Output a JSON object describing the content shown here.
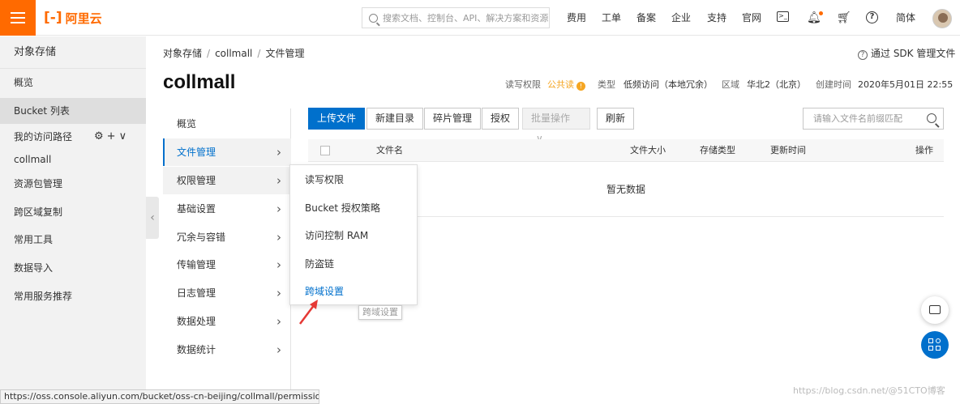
{
  "topbar": {
    "logo_text": "阿里云",
    "search_placeholder": "搜索文档、控制台、API、解决方案和资源",
    "nav": [
      "费用",
      "工单",
      "备案",
      "企业",
      "支持",
      "官网"
    ],
    "lang": "简体"
  },
  "left": {
    "title": "对象存储",
    "items": [
      "概览",
      "Bucket 列表",
      "我的访问路径",
      "collmall",
      "资源包管理",
      "跨区域复制",
      "常用工具",
      "数据导入",
      "常用服务推荐"
    ],
    "active_index": 1
  },
  "header": {
    "breadcrumb": [
      "对象存储",
      "collmall",
      "文件管理"
    ],
    "sdk_link": "通过 SDK 管理文件",
    "bucket_name": "collmall",
    "meta": {
      "rw_label": "读写权限",
      "rw_value": "公共读",
      "type_label": "类型",
      "type_value": "低频访问（本地冗余）",
      "region_label": "区域",
      "region_value": "华北2（北京）",
      "created_label": "创建时间",
      "created_value": "2020年5月01日 22:55"
    }
  },
  "sub_nav": {
    "items": [
      "概览",
      "文件管理",
      "权限管理",
      "基础设置",
      "冗余与容错",
      "传输管理",
      "日志管理",
      "数据处理",
      "数据统计"
    ],
    "active_index": 1,
    "hover_index": 2
  },
  "toolbar": {
    "upload": "上传文件",
    "new_dir": "新建目录",
    "fragments": "碎片管理",
    "authorize": "授权",
    "batch": "批量操作",
    "refresh": "刷新",
    "search_placeholder": "请输入文件名前缀匹配"
  },
  "table": {
    "columns": [
      "文件名",
      "文件大小",
      "存储类型",
      "更新时间",
      "操作"
    ],
    "empty_text": "暂无数据"
  },
  "popup": {
    "items": [
      "读写权限",
      "Bucket 授权策略",
      "访问控制 RAM",
      "防盗链",
      "跨域设置"
    ],
    "active_index": 4,
    "tooltip": "跨域设置"
  },
  "statusbar": "https://oss.console.aliyun.com/bucket/oss-cn-beijing/collmall/permission#c...",
  "watermark": "https://blog.csdn.net/@51CTO博客",
  "colors": {
    "brand": "#ff6a00",
    "primary": "#0070cc",
    "warning": "#f5a623"
  }
}
